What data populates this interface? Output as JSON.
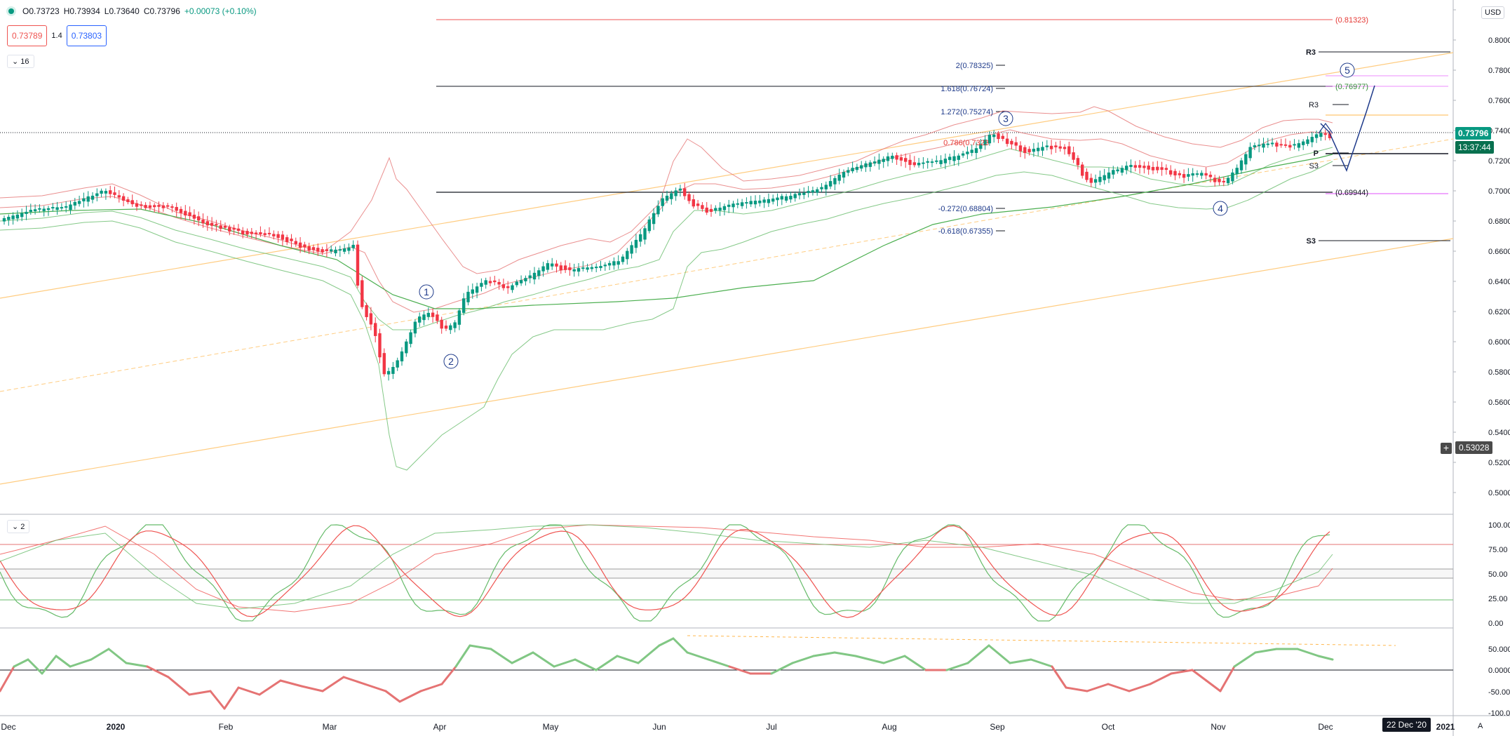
{
  "header": {
    "open": "O0.73723",
    "high": "H0.73934",
    "low": "L0.73640",
    "close": "C0.73796",
    "change": "+0.00073 (+0.10%)",
    "bid": "0.73789",
    "spread": "1.4",
    "ask": "0.73803",
    "main_collapse": "16",
    "currency": "USD"
  },
  "price_axis": {
    "ticks": [
      "0.8",
      "0.80000",
      "0.78000",
      "0.76000",
      "0.74000",
      "0.72000",
      "0.70000",
      "0.68000",
      "0.66000",
      "0.64000",
      "0.62000",
      "0.60000",
      "0.58000",
      "0.56000",
      "0.54000",
      "0.52000",
      "0.50000"
    ],
    "last_price": "0.73796",
    "countdown": "13:37:44",
    "crosshair_price": "0.53028"
  },
  "time_axis": {
    "labels": [
      "Dec",
      "2020",
      "Feb",
      "Mar",
      "Apr",
      "May",
      "Jun",
      "Jul",
      "Aug",
      "Sep",
      "Oct",
      "Nov",
      "Dec",
      "2021"
    ],
    "crosshair_date": "22 Dec '20",
    "auto_label": "A"
  },
  "annotations": {
    "fib_levels": [
      "2(0.78325)",
      "1.618(0.76724)",
      "1.272(0.75274)",
      "0.786(0.7323",
      "-0.272(0.68804)",
      "-0.618(0.67355)"
    ],
    "price_labels": [
      "(0.81323)",
      "(0.76977)",
      "(0.69944)"
    ],
    "pivots": [
      "R3",
      "R3",
      "P",
      "S3",
      "S3"
    ],
    "waves": [
      "1",
      "2",
      "3",
      "4",
      "5"
    ]
  },
  "stoch_panel": {
    "collapse": "2",
    "ticks": [
      "100.00",
      "75.00",
      "50.00",
      "25.00",
      "0.00"
    ]
  },
  "osc_panel": {
    "ticks": [
      "50.00000",
      "0.00000",
      "-50.00000",
      "-100.00000"
    ]
  },
  "colors": {
    "up": "#089981",
    "down": "#f23645",
    "upper_band": "#e57373",
    "lower_band": "#66bb6a",
    "channel": "#ffcc80",
    "fib": "#1e3a8a"
  }
}
